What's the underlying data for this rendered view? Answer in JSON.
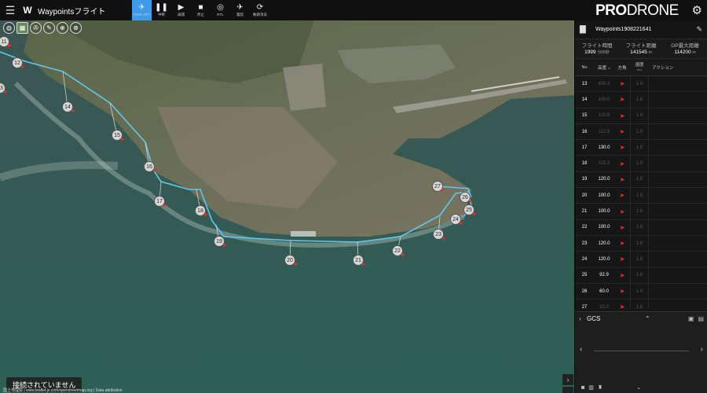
{
  "topbar": {
    "menu_icon": "menu-icon",
    "logo_icon": "waypoints-logo-icon",
    "mode_title": "Waypointsフライト",
    "buttons": [
      {
        "icon": "drone-takeoff-icon",
        "glyph": "✈",
        "label": "TAKE OFF",
        "active": true
      },
      {
        "icon": "pause-icon",
        "glyph": "❚❚",
        "label": "中断",
        "active": false
      },
      {
        "icon": "play-icon",
        "glyph": "▶",
        "label": "再開",
        "active": false
      },
      {
        "icon": "stop-icon",
        "glyph": "■",
        "label": "停止",
        "active": false
      },
      {
        "icon": "rtl-icon",
        "glyph": "◎",
        "label": "RTL",
        "active": false
      },
      {
        "icon": "landing-icon",
        "glyph": "✈",
        "label": "着陸",
        "active": false
      },
      {
        "icon": "clear-path-icon",
        "glyph": "⟳",
        "label": "軌跡消去",
        "active": false
      }
    ],
    "brand_bold": "PRO",
    "brand_rest": "DRONE"
  },
  "map": {
    "tool_icons": [
      "globe-icon",
      "map-layer-icon",
      "drone-icon",
      "draw-icon",
      "crosshair-icon",
      "compass-icon"
    ],
    "status_text": "接続されていません",
    "attribution": "国土地理院 | www.leaflet.js.com/openstreetmap.org | Data attribution"
  },
  "waypoint_markers": [
    {
      "label": "11"
    },
    {
      "label": "12"
    },
    {
      "label": "13"
    },
    {
      "label": "14"
    },
    {
      "label": "15"
    },
    {
      "label": "16"
    },
    {
      "label": "17"
    },
    {
      "label": "18"
    },
    {
      "label": "19"
    },
    {
      "label": "20"
    },
    {
      "label": "21"
    },
    {
      "label": "22"
    },
    {
      "label": "23"
    },
    {
      "label": "24"
    },
    {
      "label": "25"
    },
    {
      "label": "26"
    },
    {
      "label": "27"
    }
  ],
  "mission": {
    "name": "Waypoints1908221641",
    "stats": [
      {
        "label": "フライト時間",
        "value": "1999",
        "unit": "分05秒"
      },
      {
        "label": "フライト距離",
        "value": "141545",
        "unit": "m"
      },
      {
        "label": "OP最大距離",
        "value": "114200",
        "unit": "m"
      }
    ]
  },
  "table": {
    "headers": {
      "no": "No",
      "alt": "高度",
      "alt_unit": "m",
      "dir": "方角",
      "spd": "速度",
      "spd_unit": "m/s",
      "act": "アクション"
    },
    "rows": [
      {
        "no": "13",
        "alt": "406.3",
        "dim": true,
        "dir": "➤",
        "spd": "1.8"
      },
      {
        "no": "14",
        "alt": "100.0",
        "dim": true,
        "dir": "➤",
        "spd": "1.8"
      },
      {
        "no": "15",
        "alt": "110.8",
        "dim": true,
        "dir": "➤",
        "spd": "1.8"
      },
      {
        "no": "16",
        "alt": "112.5",
        "dim": true,
        "dir": "➤",
        "spd": "1.8"
      },
      {
        "no": "17",
        "alt": "130.0",
        "dim": false,
        "dir": "➤",
        "spd": "1.8"
      },
      {
        "no": "18",
        "alt": "125.5",
        "dim": true,
        "dir": "➤",
        "spd": "1.8"
      },
      {
        "no": "19",
        "alt": "120.0",
        "dim": false,
        "dir": "➤",
        "spd": "1.8"
      },
      {
        "no": "20",
        "alt": "100.0",
        "dim": false,
        "dir": "➤",
        "spd": "1.8"
      },
      {
        "no": "21",
        "alt": "100.0",
        "dim": false,
        "dir": "➤",
        "spd": "1.8"
      },
      {
        "no": "22",
        "alt": "100.0",
        "dim": false,
        "dir": "➤",
        "spd": "1.8"
      },
      {
        "no": "23",
        "alt": "120.0",
        "dim": false,
        "dir": "➤",
        "spd": "1.8"
      },
      {
        "no": "24",
        "alt": "120.0",
        "dim": false,
        "dir": "➤",
        "spd": "1.8"
      },
      {
        "no": "25",
        "alt": "92.9",
        "dim": false,
        "dir": "➤",
        "spd": "1.8"
      },
      {
        "no": "26",
        "alt": "60.0",
        "dim": false,
        "dir": "➤",
        "spd": "1.8"
      },
      {
        "no": "27",
        "alt": "15.0",
        "dim": true,
        "dir": "➤",
        "spd": "1.8"
      }
    ]
  },
  "gcs": {
    "title": "GCS",
    "icons": [
      "camera-icon",
      "grid-icon",
      "drone-icon"
    ]
  },
  "colors": {
    "accent": "#3d9be9",
    "heading_arrow": "#e53030",
    "path_line": "#5fc8ec"
  }
}
